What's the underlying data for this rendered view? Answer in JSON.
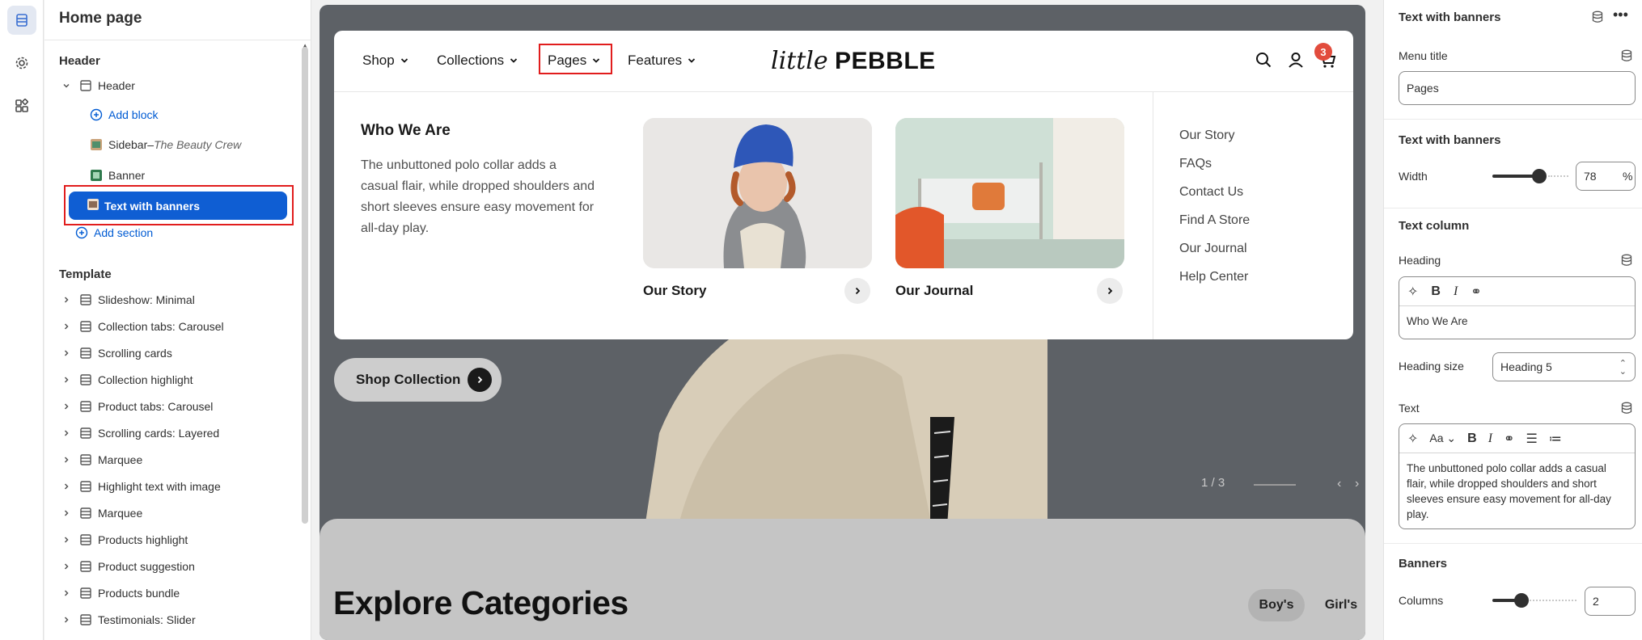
{
  "left_sidebar": {
    "title": "Home page",
    "header_group_label": "Header",
    "header_item": "Header",
    "add_block": "Add block",
    "sidebar_item": "Sidebar",
    "sidebar_sep": " – ",
    "sidebar_sub": "The Beauty Crew",
    "banner_item": "Banner",
    "selected_item": "Text with banners",
    "add_section": "Add section",
    "template_label": "Template",
    "template_items": [
      "Slideshow: Minimal",
      "Collection tabs: Carousel",
      "Scrolling cards",
      "Collection highlight",
      "Product tabs: Carousel",
      "Scrolling cards: Layered",
      "Marquee",
      "Highlight text with image",
      "Marquee",
      "Products highlight",
      "Product suggestion",
      "Products bundle",
      "Testimonials: Slider"
    ]
  },
  "preview": {
    "nav": [
      "Shop",
      "Collections",
      "Pages",
      "Features"
    ],
    "logo_script": "little",
    "logo_bold": "PEBBLE",
    "cart_count": "3",
    "mega_heading": "Who We Are",
    "mega_text": "The unbuttoned polo collar adds a casual flair, while dropped shoulders and short sleeves ensure easy movement for all-day play.",
    "banners": [
      "Our Story",
      "Our Journal"
    ],
    "links": [
      "Our Story",
      "FAQs",
      "Contact Us",
      "Find A Store",
      "Our Journal",
      "Help Center"
    ],
    "shop_button": "Shop Collection",
    "slide_counter": "1 / 3",
    "explore_title": "Explore Categories",
    "tabs": [
      "Boy's",
      "Girl's"
    ]
  },
  "settings": {
    "title": "Text with banners",
    "menu_title_label": "Menu title",
    "menu_title_value": "Pages",
    "section_text_banners": "Text with banners",
    "width_label": "Width",
    "width_value": "78",
    "width_unit": "%",
    "width_fraction": 0.78,
    "text_column_label": "Text column",
    "heading_label": "Heading",
    "heading_value": "Who We Are",
    "heading_size_label": "Heading size",
    "heading_size_value": "Heading 5",
    "text_label": "Text",
    "text_value": "The unbuttoned polo collar adds a casual flair, while dropped shoulders and short sleeves ensure easy movement for all-day play.",
    "banners_label": "Banners",
    "columns_label": "Columns",
    "columns_value": "2"
  },
  "colors": {
    "accent_blue": "#0f5ed3",
    "highlight_red": "#e11d1d",
    "cart_badge": "#e24c3d"
  }
}
